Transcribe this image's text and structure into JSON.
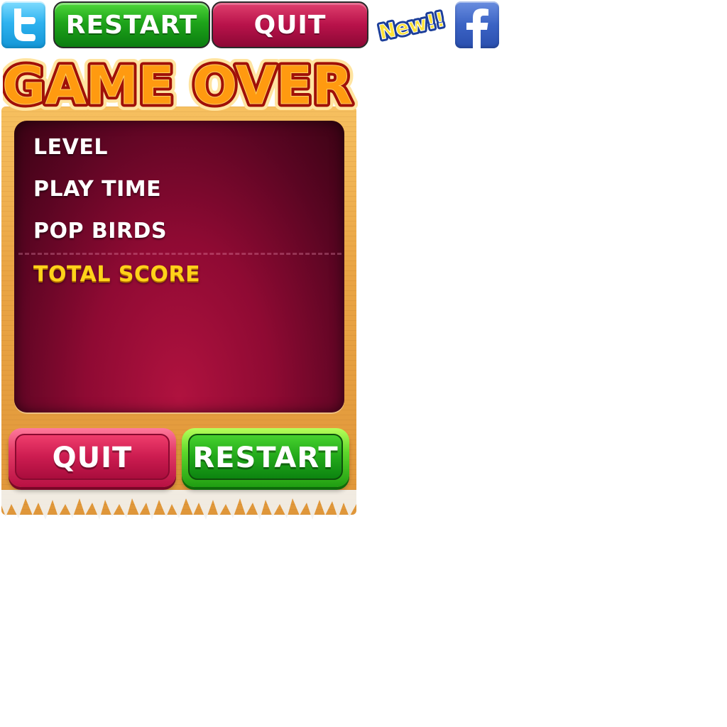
{
  "sprites": {
    "top_restart_label": "RESTART",
    "top_quit_label": "QUIT",
    "new_badge_text": "New!!",
    "twitter_icon": "twitter-bird-icon",
    "facebook_icon": "facebook-f-icon"
  },
  "game_over": {
    "title": "GAME OVER",
    "stats": {
      "level_label": "LEVEL",
      "play_time_label": "PLAY TIME",
      "pop_birds_label": "POP BIRDS",
      "total_score_label": "TOTAL SCORE"
    },
    "buttons": {
      "quit_label": "QUIT",
      "restart_label": "RESTART"
    }
  },
  "colors": {
    "restart_green": "#1ea41a",
    "quit_red": "#b8124a",
    "total_score_yellow": "#ffd21a",
    "panel_maroon": "#8f0a33",
    "wood": "#eaa544",
    "title_orange": "#ff8a00"
  }
}
